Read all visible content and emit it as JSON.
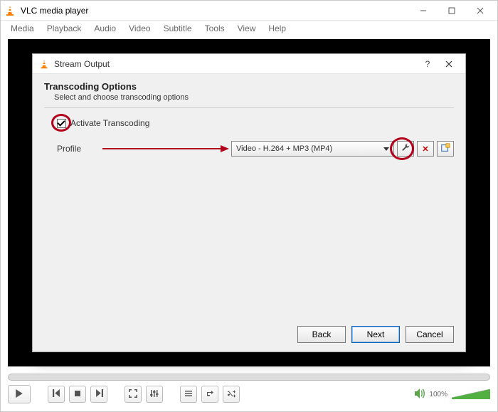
{
  "window": {
    "title": "VLC media player"
  },
  "menubar": {
    "items": [
      "Media",
      "Playback",
      "Audio",
      "Video",
      "Subtitle",
      "Tools",
      "View",
      "Help"
    ]
  },
  "dialog": {
    "title": "Stream Output",
    "section_title": "Transcoding Options",
    "section_subtitle": "Select and choose transcoding options",
    "activate_label": "Activate Transcoding",
    "activate_checked": true,
    "profile_label": "Profile",
    "profile_value": "Video - H.264 + MP3 (MP4)",
    "buttons": {
      "back": "Back",
      "next": "Next",
      "cancel": "Cancel"
    },
    "help_symbol": "?"
  },
  "controls": {
    "volume_text": "100%"
  }
}
